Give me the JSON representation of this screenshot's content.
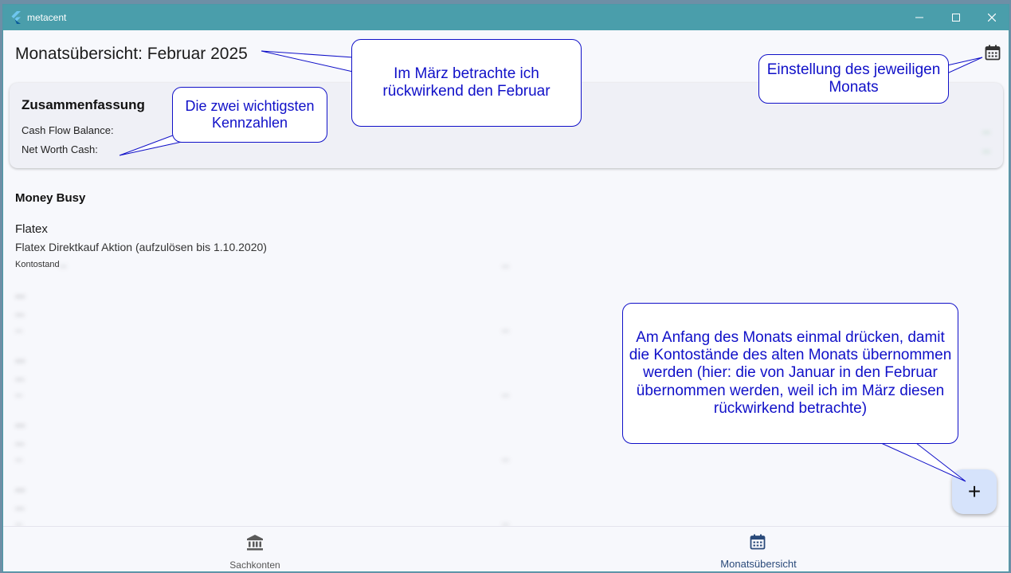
{
  "window": {
    "app_title": "metacent"
  },
  "header": {
    "title": "Monatsübersicht: Februar 2025"
  },
  "summary": {
    "title": "Zusammenfassung",
    "cash_flow_label": "Cash Flow Balance:",
    "net_worth_label": "Net Worth Cash:",
    "cash_flow_value": "...",
    "net_worth_value": "..."
  },
  "section": {
    "title": "Money Busy"
  },
  "accounts": [
    {
      "name": "Flatex",
      "subtitle": "Flatex Direktkauf Aktion (aufzulösen bis 1.10.2020)",
      "balance_label": "Kontostand",
      "balance_value": "...",
      "budget": "..."
    },
    {
      "name": "...",
      "subtitle": "...",
      "balance_label": "...",
      "balance_value": "",
      "budget": "..."
    },
    {
      "name": "...",
      "subtitle": "...",
      "balance_label": "...",
      "balance_value": "",
      "budget": "..."
    },
    {
      "name": "...",
      "subtitle": "...",
      "balance_label": "...",
      "balance_value": "",
      "budget": "..."
    },
    {
      "name": "...",
      "subtitle": "...",
      "balance_label": "...",
      "balance_value": "",
      "budget": "..."
    }
  ],
  "nav": {
    "items": [
      {
        "label": "Sachkonten",
        "icon": "bank-icon",
        "active": false
      },
      {
        "label": "Monatsübersicht",
        "icon": "calendar-icon",
        "active": true
      }
    ]
  },
  "fab": {
    "icon": "plus-icon",
    "label": "+"
  },
  "annotations": {
    "month_note": "Im März betrachte ich rückwirkend den Februar",
    "kpi_note": "Die zwei wichtigsten Kennzahlen",
    "calendar_note": "Einstellung des jeweiligen Monats",
    "fab_note": "Am Anfang des Monats einmal drücken, damit die Kontostände des alten Monats übernommen werden (hier: die von Januar in den Februar übernommen werden, weil ich im März diesen rückwirkend betrachte)"
  },
  "colors": {
    "titlebar": "#4a9eab",
    "background": "#f7f8fc",
    "nav_active": "#2a4a7a",
    "callout_text": "#1010c8",
    "positive_value": "#2e9e44",
    "fab": "#d6e3fb"
  }
}
